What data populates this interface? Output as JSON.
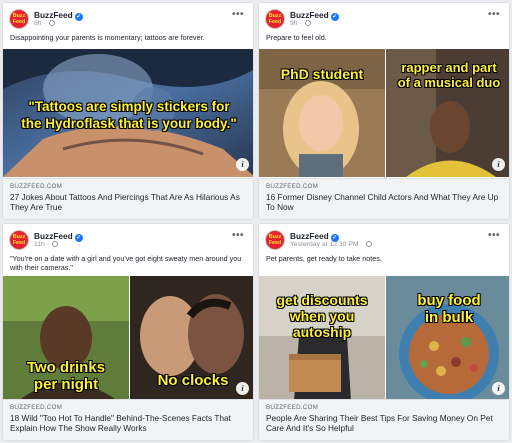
{
  "posts": [
    {
      "page_name": "BuzzFeed",
      "time": "8h",
      "caption": "Disappointing your parents is momentary; tattoos are forever.",
      "overlay": [
        "\"Tattoos are simply stickers for",
        "the Hydroflask that is your body.\""
      ],
      "domain": "BUZZFEED.COM",
      "title": "27 Jokes About Tattoos And Piercings That Are As Hilarious As They Are True"
    },
    {
      "page_name": "BuzzFeed",
      "time": "9h",
      "caption": "Prepare to feel old.",
      "overlay_left": "PhD student",
      "overlay_right": [
        "rapper and part",
        "of a musical duo"
      ],
      "domain": "BUZZFEED.COM",
      "title": "16 Former Disney Channel Child Actors And What They Are Up To Now"
    },
    {
      "page_name": "BuzzFeed",
      "time": "11h",
      "caption": "\"You're on a date with a girl and you've got eight sweaty men around you with their cameras.\"",
      "overlay_left": [
        "Two drinks",
        "per night"
      ],
      "overlay_right": "No clocks",
      "domain": "BUZZFEED.COM",
      "title": "18 Wild \"Too Hot To Handle\" Behind-The-Scenes Facts That Explain How The Show Really Works"
    },
    {
      "page_name": "BuzzFeed",
      "time": "Yesterday at 12:30 PM",
      "caption": "Pet parents, get ready to take notes.",
      "overlay_left": [
        "get discounts",
        "when you",
        "autoship"
      ],
      "overlay_right": [
        "buy food",
        "in bulk"
      ],
      "domain": "BUZZFEED.COM",
      "title": "People Are Sharing Their Best Tips For Saving Money On Pet Care And It's So Helpful"
    }
  ],
  "logo_text": [
    "Buzz",
    "Feed"
  ],
  "more_glyph": "•••",
  "info_glyph": "i",
  "verified_glyph": "✓",
  "colors": {
    "brand": "#e6232d",
    "verified": "#1877f2",
    "overlay_yellow": "#fff23a"
  },
  "icons": [
    "buzzfeed-logo-icon",
    "verified-icon",
    "globe-icon",
    "more-icon",
    "info-icon"
  ]
}
